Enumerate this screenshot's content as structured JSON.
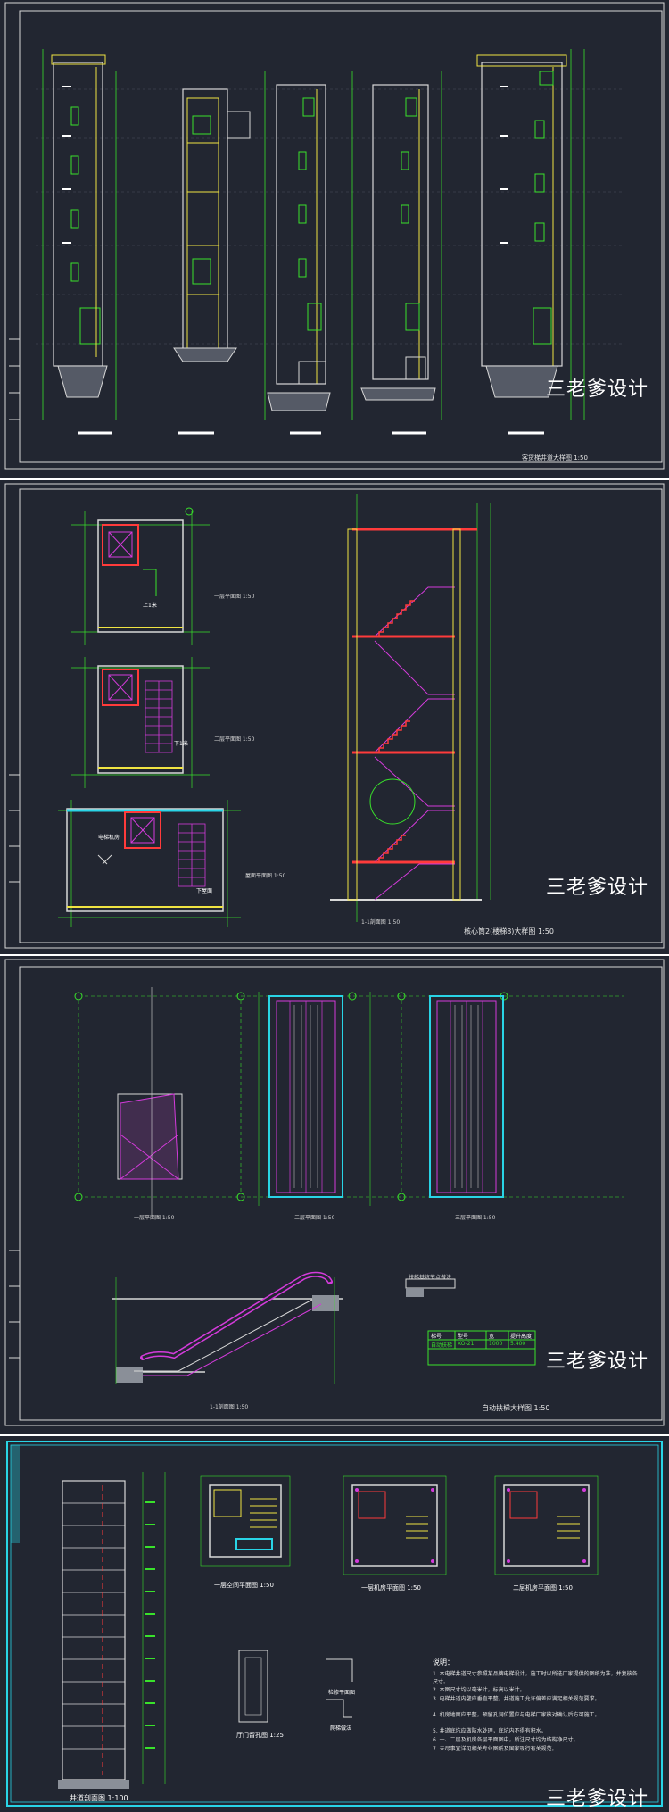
{
  "watermark": "三老爹设计",
  "sheets": [
    {
      "id": "elevator-sections",
      "title": "客货梯井道大样图 1:50"
    },
    {
      "id": "core-stair",
      "title": "核心筒2(楼梯8)大样图 1:50",
      "plans": [
        "一层平面图 1:50",
        "二层平面图 1:50",
        "屋面平面图 1:50"
      ],
      "section": "1-1剖面图 1:50",
      "notes": [
        "上1米",
        "下1米",
        "电梯机房",
        "下屋面"
      ]
    },
    {
      "id": "escalator",
      "title": "自动扶梯大样图 1:50",
      "plans": [
        "一层平面图 1:50",
        "二层平面图 1:50",
        "三层平面图 1:50"
      ],
      "section": "1-1剖面图 1:50",
      "detail": "扶梯基坑节点做法",
      "table_header": [
        "梯号",
        "型号",
        "宽",
        "提升高度"
      ],
      "table_cells": [
        "自动扶梯",
        "XO-21",
        "1000",
        "5.400"
      ]
    },
    {
      "id": "elevator-shaft",
      "section": "井道剖面图 1:100",
      "plans": [
        "一层空间平面图 1:50",
        "一层机房平面图 1:50",
        "二层机房平面图 1:50"
      ],
      "door": "厅门留孔图 1:25",
      "small": [
        "检修平面图",
        "爬梯做法"
      ],
      "notes_title": "说明：",
      "notes": [
        "1. 本电梯井道尺寸参照某品牌电梯设计，施工时以所选厂家提供的图纸为准，并复核各尺寸。",
        "2. 本图尺寸均以毫米计，标高以米计。",
        "3. 电梯井道内壁应垂直平整，井道施工允许偏差应满足相关规范要求。",
        "4. 机房地面应平整，预留孔洞位置应与电梯厂家核对确认后方可施工。",
        "5. 井道底坑应做防水处理，底坑内不得有积水。",
        "6. 一、二层及机房各层平面图中，所注尺寸均为结构净尺寸。",
        "7. 未尽事宜详见相关专业图纸及国家现行有关规范。"
      ]
    }
  ],
  "colors": {
    "background": "#222631",
    "frame": "#d8d8d8",
    "green": "#39e22b",
    "yellow": "#f0e442",
    "magenta": "#d43bdb",
    "cyan": "#29d4e6",
    "red": "#ff3b3b",
    "white": "#ffffff",
    "gray": "#8a8f98"
  }
}
